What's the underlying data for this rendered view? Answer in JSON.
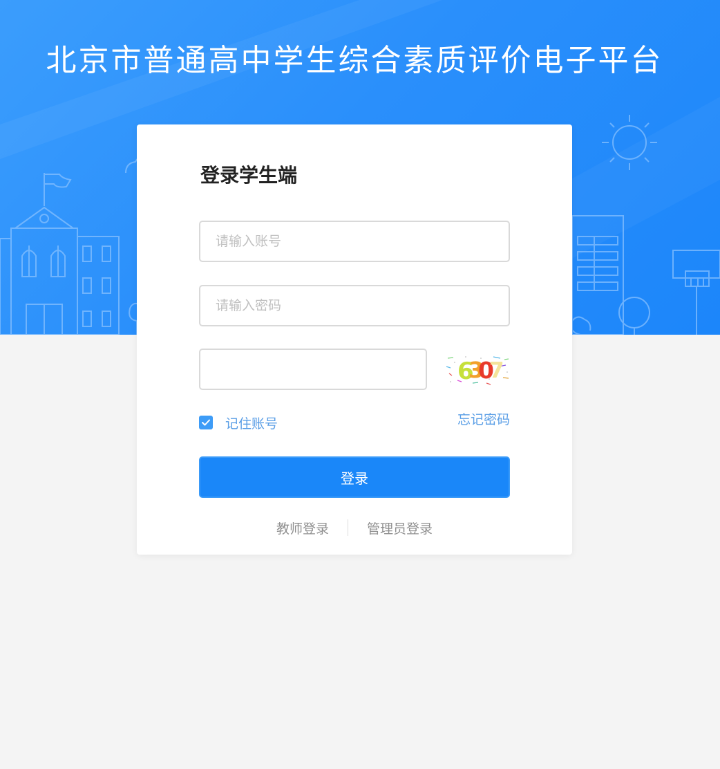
{
  "site": {
    "title": "北京市普通高中学生综合素质评价电子平台"
  },
  "login": {
    "heading": "登录学生端",
    "account_placeholder": "请输入账号",
    "password_placeholder": "请输入密码",
    "captcha_value": "",
    "captcha_text": "6307",
    "remember_label": "记住账号",
    "remember_checked": true,
    "forgot_label": "忘记密码",
    "submit_label": "登录",
    "teacher_login_label": "教师登录",
    "admin_login_label": "管理员登录"
  },
  "colors": {
    "brand": "#1a87f9",
    "link": "#5a9ee6",
    "page_bg": "#f4f4f4"
  }
}
